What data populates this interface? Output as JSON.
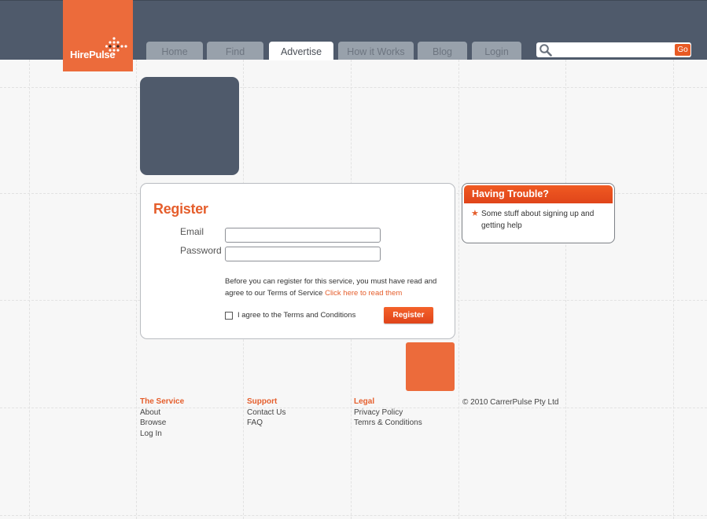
{
  "brand": {
    "name": "HirePulse",
    "accent": "#ec6b3b",
    "header_bg": "#4f5a6b"
  },
  "nav": {
    "tabs": [
      {
        "label": "Home"
      },
      {
        "label": "Find"
      },
      {
        "label": "Advertise"
      },
      {
        "label": "How it Works"
      },
      {
        "label": "Blog"
      },
      {
        "label": "Login"
      }
    ],
    "active": "Advertise"
  },
  "search": {
    "value": "",
    "placeholder": "",
    "button_label": "Go",
    "icon": "search-icon"
  },
  "register": {
    "title": "Register",
    "email_label": "Email",
    "email_value": "",
    "password_label": "Password",
    "password_value": "",
    "terms_text": "Before you can register for this service, you must have read and agree to our Terms of Service",
    "terms_link": "Click here to read them",
    "agree_label": "I agree to the Terms and Conditions",
    "agree_checked": false,
    "button_label": "Register"
  },
  "trouble": {
    "title": "Having Trouble?",
    "items": [
      "Some stuff about signing up and getting help"
    ]
  },
  "footer": {
    "columns": [
      {
        "heading": "The Service",
        "links": [
          "About",
          "Browse",
          "Log In"
        ]
      },
      {
        "heading": "Support",
        "links": [
          "Contact Us",
          "FAQ"
        ]
      },
      {
        "heading": "Legal",
        "links": [
          "Privacy Policy",
          "Temrs & Conditions"
        ]
      }
    ],
    "copyright": "© 2010 CarrerPulse Pty Ltd"
  }
}
